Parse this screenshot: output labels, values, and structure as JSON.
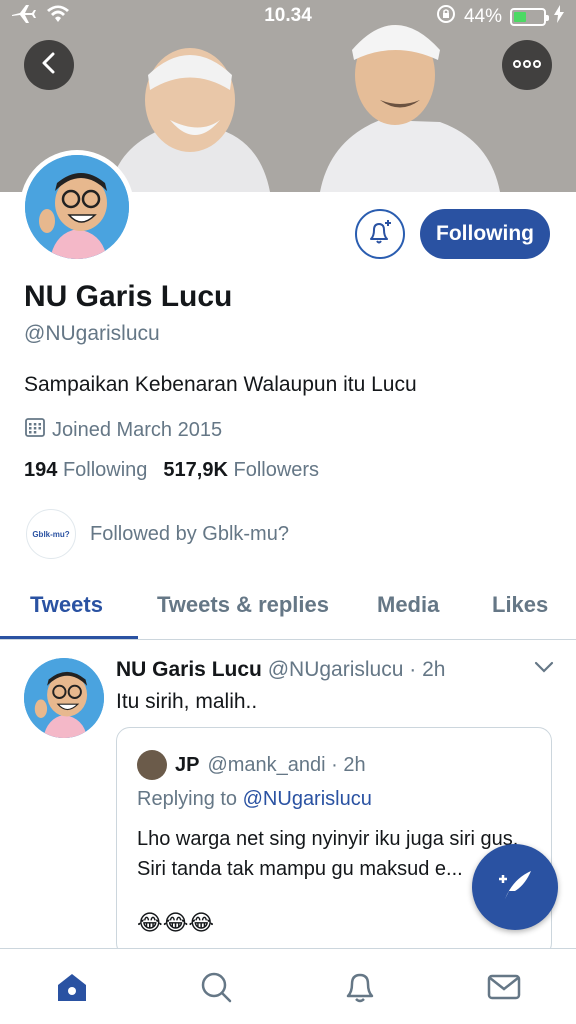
{
  "status_bar": {
    "time": "10.34",
    "battery_label": "44%",
    "battery_level": 0.44,
    "icons": [
      "airplane-icon",
      "wifi-icon",
      "orientation-lock-icon",
      "battery-icon",
      "charging-icon"
    ]
  },
  "header": {
    "back_icon": "chevron-left-icon",
    "more_icon": "more-horizontal-icon"
  },
  "profile": {
    "name": "NU Garis Lucu",
    "handle": "@NUgarislucu",
    "bio": "Sampaikan Kebenaran Walaupun itu Lucu",
    "joined": "Joined March 2015",
    "following_count": "194",
    "following_label": "Following",
    "followers_count": "517,9K",
    "followers_label": "Followers",
    "followed_by": "Followed by Gblk-mu?",
    "followed_by_avatar_text": "Gblk-mu?",
    "follow_button": "Following"
  },
  "tabs": [
    {
      "label": "Tweets",
      "active": true
    },
    {
      "label": "Tweets & replies",
      "active": false
    },
    {
      "label": "Media",
      "active": false
    },
    {
      "label": "Likes",
      "active": false
    }
  ],
  "tweet": {
    "author": "NU Garis Lucu",
    "meta": "@NUgarislucu · 2h",
    "text": "Itu sirih, malih..",
    "quote": {
      "author": "JP",
      "meta": "@mank_andi · 2h",
      "reply_prefix": "Replying to",
      "reply_handle": "@NUgarislucu",
      "text": "Lho warga net sing nyinyir iku juga siri gus, Siri tanda tak mampu gu maksud e...",
      "emoji": "😂😂😂"
    }
  },
  "bottom_nav": [
    {
      "icon": "home-icon",
      "active": true
    },
    {
      "icon": "search-icon",
      "active": false
    },
    {
      "icon": "notifications-icon",
      "active": false
    },
    {
      "icon": "messages-icon",
      "active": false
    }
  ],
  "colors": {
    "accent": "#2a52a2",
    "secondary_text": "#657786",
    "battery_green": "#4cd964"
  }
}
